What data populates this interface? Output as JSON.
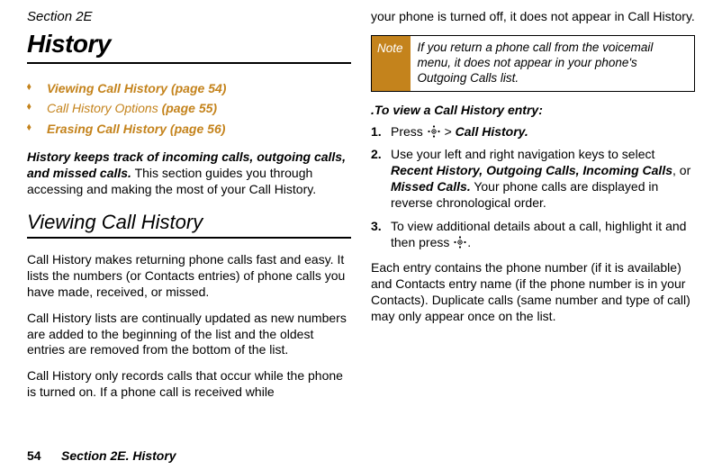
{
  "left": {
    "section_label": "Section 2E",
    "title": "History",
    "contents": [
      {
        "label": "Viewing Call History",
        "page": " (page 54)"
      },
      {
        "label": "Call History Options",
        "page": " (page 55)"
      },
      {
        "label": "Erasing Call History",
        "page": " (page 56)"
      }
    ],
    "intro_bold": "History keeps track of incoming calls, outgoing calls, and missed calls.",
    "intro_rest": " This section guides you through accessing and making the most of your Call History.",
    "h2": "Viewing Call History",
    "p1": "Call History makes returning phone calls fast and easy. It lists the numbers (or Contacts entries) of phone calls you have made, received, or missed.",
    "p2": "Call History lists are continually updated as new numbers are added to the beginning of the list and the oldest entries are removed from the bottom of the list.",
    "p3": "Call History only records calls that occur while the phone is turned on. If a phone call is received while"
  },
  "right": {
    "continued": "your phone is turned off, it does not appear in Call History.",
    "note_label": "Note",
    "note_text": "If you return a phone call from the voicemail menu, it does not appear in your phone's Outgoing Calls list.",
    "task": ".To view a Call History entry:",
    "step1_pre": "Press ",
    "step1_post": " > ",
    "step1_ui": "Call History.",
    "step2_pre": "Use your left and right navigation keys to select ",
    "step2_u1": "Recent History,",
    "step2_u2": " Outgoing Calls",
    "step2_u3": ", Incoming Calls",
    "step2_or": ", or ",
    "step2_u4": "Missed Calls.",
    "step2_post": " Your phone calls are displayed in reverse chronological order.",
    "step3_pre": "To view additional details about a call, highlight it and then press ",
    "step3_post": ".",
    "closing": "Each entry contains the phone number (if it is available) and Contacts entry name (if the phone number is in your Contacts). Duplicate calls (same number and type of call) may only appear once on the list."
  },
  "footer": {
    "page_num": "54",
    "section": "Section 2E. History"
  }
}
